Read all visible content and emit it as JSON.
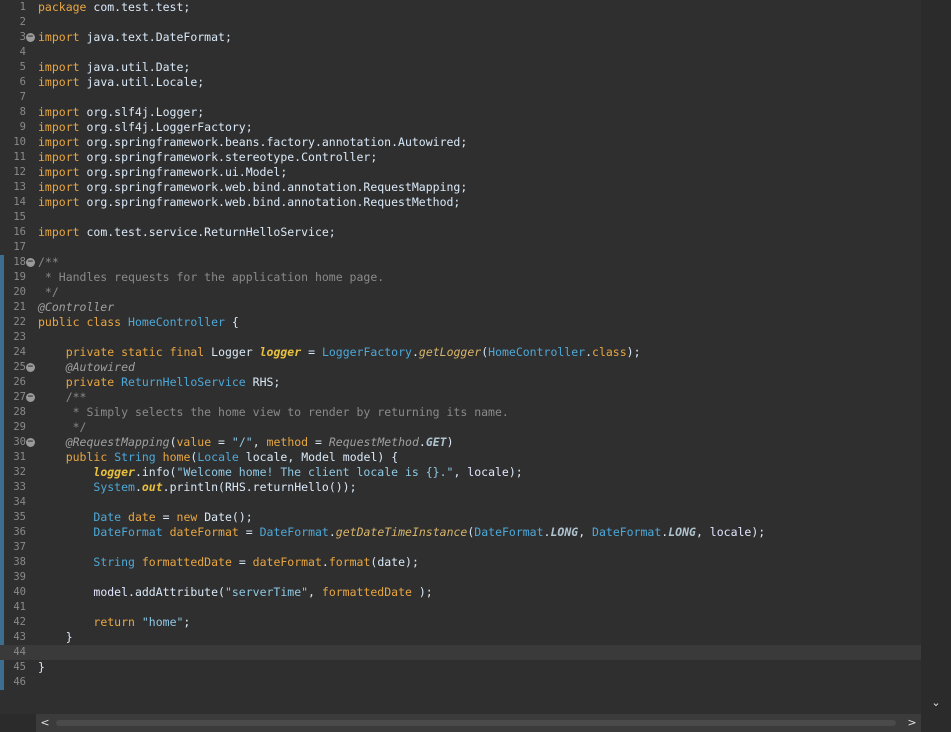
{
  "editor": {
    "current_line": 44,
    "folds": [
      3,
      18,
      25,
      27,
      30
    ],
    "changed_ranges": [
      [
        18,
        46
      ]
    ],
    "lines": [
      [
        [
          "kw",
          "package"
        ],
        [
          "t",
          " com.test.test;"
        ]
      ],
      [],
      [
        [
          "kw",
          "import"
        ],
        [
          "t",
          " java.text.DateFormat;"
        ]
      ],
      [],
      [
        [
          "kw",
          "import"
        ],
        [
          "t",
          " java.util.Date;"
        ]
      ],
      [
        [
          "kw",
          "import"
        ],
        [
          "t",
          " java.util.Locale;"
        ]
      ],
      [],
      [
        [
          "kw",
          "import"
        ],
        [
          "t",
          " org.slf4j.Logger;"
        ]
      ],
      [
        [
          "kw",
          "import"
        ],
        [
          "t",
          " org.slf4j.LoggerFactory;"
        ]
      ],
      [
        [
          "kw",
          "import"
        ],
        [
          "t",
          " org.springframework.beans.factory.annotation.Autowired;"
        ]
      ],
      [
        [
          "kw",
          "import"
        ],
        [
          "t",
          " org.springframework.stereotype.Controller;"
        ]
      ],
      [
        [
          "kw",
          "import"
        ],
        [
          "t",
          " org.springframework.ui.Model;"
        ]
      ],
      [
        [
          "kw",
          "import"
        ],
        [
          "t",
          " org.springframework.web.bind.annotation.RequestMapping;"
        ]
      ],
      [
        [
          "kw",
          "import"
        ],
        [
          "t",
          " org.springframework.web.bind.annotation.RequestMethod;"
        ]
      ],
      [],
      [
        [
          "kw",
          "import"
        ],
        [
          "t",
          " com.test.service.ReturnHelloService;"
        ]
      ],
      [],
      [
        [
          "cmt",
          "/**"
        ]
      ],
      [
        [
          "cmt",
          " * Handles requests for the application home page."
        ]
      ],
      [
        [
          "cmt",
          " */"
        ]
      ],
      [
        [
          "ann",
          "@Controller"
        ]
      ],
      [
        [
          "kw",
          "public"
        ],
        [
          "t",
          " "
        ],
        [
          "kw",
          "class"
        ],
        [
          "t",
          " "
        ],
        [
          "type",
          "HomeController"
        ],
        [
          "t",
          " {"
        ]
      ],
      [],
      [
        [
          "t",
          "    "
        ],
        [
          "kw",
          "private"
        ],
        [
          "t",
          " "
        ],
        [
          "kw",
          "static"
        ],
        [
          "t",
          " "
        ],
        [
          "kw",
          "final"
        ],
        [
          "t",
          " Logger "
        ],
        [
          "fld",
          "logger"
        ],
        [
          "t",
          " = "
        ],
        [
          "type",
          "LoggerFactory"
        ],
        [
          "t",
          "."
        ],
        [
          "smeth",
          "getLogger"
        ],
        [
          "t",
          "("
        ],
        [
          "type",
          "HomeController"
        ],
        [
          "t",
          "."
        ],
        [
          "kw",
          "class"
        ],
        [
          "t",
          ");"
        ]
      ],
      [
        [
          "t",
          "    "
        ],
        [
          "ann",
          "@Autowired"
        ]
      ],
      [
        [
          "t",
          "    "
        ],
        [
          "kw",
          "private"
        ],
        [
          "t",
          " "
        ],
        [
          "type",
          "ReturnHelloService"
        ],
        [
          "t",
          " RHS;"
        ]
      ],
      [
        [
          "t",
          "    "
        ],
        [
          "cmt",
          "/**"
        ]
      ],
      [
        [
          "t",
          "    "
        ],
        [
          "cmt",
          " * Simply selects the home view to render by returning its name."
        ]
      ],
      [
        [
          "t",
          "    "
        ],
        [
          "cmt",
          " */"
        ]
      ],
      [
        [
          "t",
          "    "
        ],
        [
          "ann",
          "@RequestMapping"
        ],
        [
          "t",
          "("
        ],
        [
          "meth",
          "value"
        ],
        [
          "t",
          " = "
        ],
        [
          "str",
          "\"/\""
        ],
        [
          "t",
          ", "
        ],
        [
          "meth",
          "method"
        ],
        [
          "t",
          " = "
        ],
        [
          "ann",
          "RequestMethod"
        ],
        [
          "t",
          "."
        ],
        [
          "const",
          "GET"
        ],
        [
          "t",
          ")"
        ]
      ],
      [
        [
          "t",
          "    "
        ],
        [
          "kw",
          "public"
        ],
        [
          "t",
          " "
        ],
        [
          "type",
          "String"
        ],
        [
          "t",
          " "
        ],
        [
          "meth",
          "home"
        ],
        [
          "t",
          "("
        ],
        [
          "type",
          "Locale"
        ],
        [
          "t",
          " "
        ],
        [
          "param",
          "locale"
        ],
        [
          "t",
          ", "
        ],
        [
          "t",
          "Model"
        ],
        [
          "t",
          " "
        ],
        [
          "param",
          "model"
        ],
        [
          "t",
          ") {"
        ]
      ],
      [
        [
          "t",
          "        "
        ],
        [
          "fld",
          "logger"
        ],
        [
          "t",
          ".info("
        ],
        [
          "str",
          "\"Welcome home! The client locale is {}.\""
        ],
        [
          "t",
          ", "
        ],
        [
          "loc",
          "locale"
        ],
        [
          "t",
          ");"
        ]
      ],
      [
        [
          "t",
          "        "
        ],
        [
          "type",
          "System"
        ],
        [
          "t",
          "."
        ],
        [
          "fld",
          "out"
        ],
        [
          "t",
          ".println(RHS.returnHello());"
        ]
      ],
      [],
      [
        [
          "t",
          "        "
        ],
        [
          "type",
          "Date"
        ],
        [
          "t",
          " "
        ],
        [
          "kw",
          "date"
        ],
        [
          "t",
          " = "
        ],
        [
          "kw",
          "new"
        ],
        [
          "t",
          " Date();"
        ]
      ],
      [
        [
          "t",
          "        "
        ],
        [
          "type",
          "DateFormat"
        ],
        [
          "t",
          " "
        ],
        [
          "kw",
          "dateFormat"
        ],
        [
          "t",
          " = "
        ],
        [
          "type",
          "DateFormat"
        ],
        [
          "t",
          "."
        ],
        [
          "smeth",
          "getDateTimeInstance"
        ],
        [
          "t",
          "("
        ],
        [
          "type",
          "DateFormat"
        ],
        [
          "t",
          "."
        ],
        [
          "const",
          "LONG"
        ],
        [
          "t",
          ", "
        ],
        [
          "type",
          "DateFormat"
        ],
        [
          "t",
          "."
        ],
        [
          "const",
          "LONG"
        ],
        [
          "t",
          ", "
        ],
        [
          "loc",
          "locale"
        ],
        [
          "t",
          ");"
        ]
      ],
      [],
      [
        [
          "t",
          "        "
        ],
        [
          "type",
          "String"
        ],
        [
          "t",
          " "
        ],
        [
          "kw",
          "formattedDate"
        ],
        [
          "t",
          " = "
        ],
        [
          "kw",
          "dateFormat"
        ],
        [
          "t",
          "."
        ],
        [
          "meth",
          "format"
        ],
        [
          "t",
          "(date);"
        ]
      ],
      [],
      [
        [
          "t",
          "        "
        ],
        [
          "loc",
          "model"
        ],
        [
          "t",
          ".addAttribute("
        ],
        [
          "str",
          "\"serverTime\""
        ],
        [
          "t",
          ", "
        ],
        [
          "kw",
          "formattedDate"
        ],
        [
          "t",
          " );"
        ]
      ],
      [],
      [
        [
          "t",
          "        "
        ],
        [
          "kw",
          "return"
        ],
        [
          "t",
          " "
        ],
        [
          "str",
          "\"home\""
        ],
        [
          "t",
          ";"
        ]
      ],
      [
        [
          "t",
          "    }"
        ]
      ],
      [],
      [
        [
          "t",
          "}"
        ]
      ],
      []
    ]
  },
  "scrollbars": {
    "down_arrow": "⌄",
    "left_arrow": "<",
    "right_arrow": ">"
  }
}
